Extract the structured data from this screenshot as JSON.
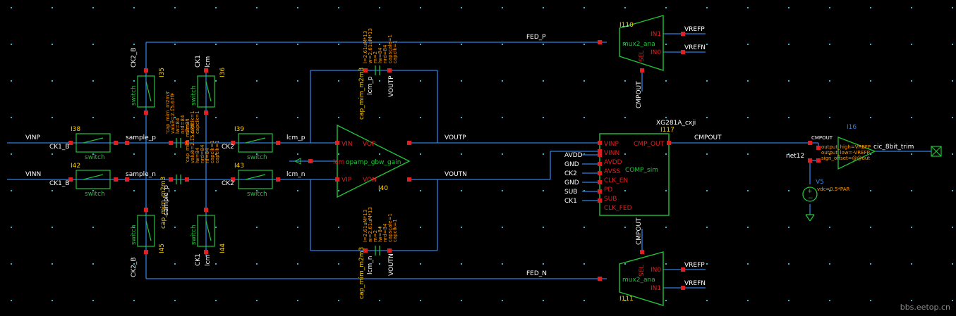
{
  "colors": {
    "background": "#000000",
    "wire": "#2f7fe0",
    "device": "#22c23a",
    "pin": "#e02020",
    "pin_label": "#e02020",
    "net_label": "#ffffff",
    "instance": "#ffd000",
    "param": "#ff9a00",
    "grid": "#2fb8c8",
    "gnd": "#22c23a"
  },
  "nets": {
    "vinp": "VINP",
    "vinn": "VINN",
    "fed_p": "FED_P",
    "fed_n": "FED_N",
    "voutp": "VOUTP",
    "voutn": "VOUTN",
    "cmpout": "CMPOUT",
    "sample_p": "sample_p",
    "sample_n": "sample_n",
    "lcm_p": "lcm_p",
    "lcm_n": "lcm_n",
    "net12": "net12"
  },
  "instances": {
    "i38": "I38",
    "i42": "I42",
    "i39": "I39",
    "i43": "I43",
    "i35": "I35",
    "i36": "I36",
    "i45": "I45",
    "i44": "I44",
    "i40": "I40",
    "i117": "I117",
    "i110": "I110",
    "i111": "I111",
    "i16": "I16",
    "v5": "V5"
  },
  "switch_labels": {
    "sw": "switch",
    "ck1_b": "CK1_B",
    "ck2": "CK2",
    "ck2_b": "CK2_B",
    "ck1": "CK1",
    "lcm": "lcm"
  },
  "opamp": {
    "vin": "VIN",
    "vip": "VIP",
    "vop": "VOP",
    "von": "VON",
    "name": "opamp_gbw_gain",
    "lcm_label": "lcm"
  },
  "comparator": {
    "cell": "XG281A_cxji",
    "name": "COMP_sim",
    "pins_left": [
      "VINP",
      "VINN",
      "AVDD",
      "AVSS",
      "CLK_EN",
      "PD",
      "SUB",
      "CLK_FED"
    ],
    "pins_right": [
      "CMP_OUT"
    ],
    "ext_left": [
      "AVDD",
      "GND",
      "CK2",
      "GND",
      "SUB",
      "CK1"
    ]
  },
  "mux": {
    "top_name": "mux2_ana",
    "bot_name": "mux2_ana",
    "in1": "IN1",
    "in0": "IN0",
    "sel": "SEL",
    "vrefp": "VREFP",
    "vrefn": "VREFN",
    "cmpout": "CMPOUT"
  },
  "trim": {
    "name": "cic_8bit_trim",
    "lines": [
      "CMPOUT",
      "output_high=VREFP",
      "output_low=-VREFP",
      "sign_offset=@@out"
    ],
    "v5_param": "vdc=0.5*PAR"
  },
  "caps": {
    "cap_model": "cap_mim_m2m3",
    "cap_model_q": "cap_mim_m2m3'",
    "params": [
      "l=2.61uM*13",
      "w=2.61uM*13",
      "m=2",
      "lw=84",
      "nrd=84",
      "capscale=1",
      "capclk=1"
    ],
    "mid_params": [
      "'cap_mim_m2m3'",
      "value=2.15.67fF",
      "lw=84",
      "nrd=84",
      "nf=84",
      "capclk=1",
      "capclk=1"
    ]
  },
  "watermark": "bbs.eetop.cn"
}
